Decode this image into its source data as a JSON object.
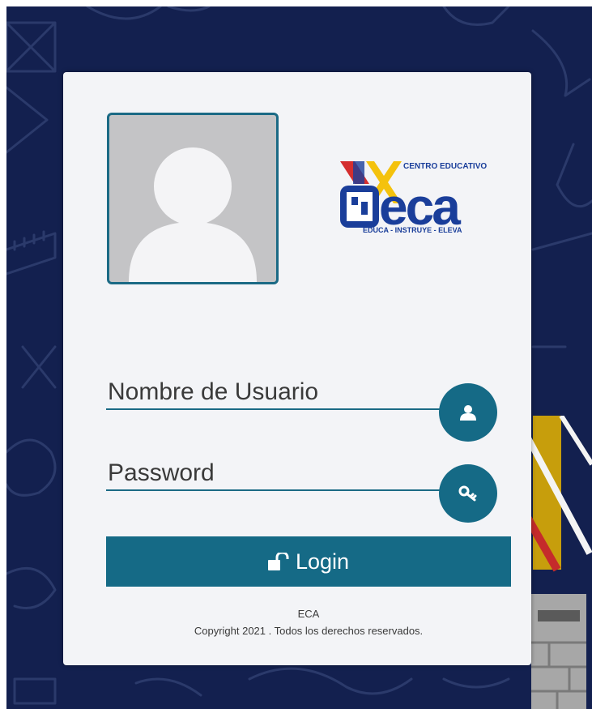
{
  "logo": {
    "top_text": "CENTRO EDUCATIVO",
    "main_text": "eca",
    "tagline": "EDUCA - INSTRUYE - ELEVA"
  },
  "form": {
    "username_placeholder": "Nombre de Usuario",
    "password_placeholder": "Password",
    "user_button_icon": "user-icon",
    "password_button_icon": "key-icon",
    "login_label": "Login",
    "login_icon": "unlock-icon"
  },
  "footer": {
    "org": "ECA",
    "copyright": "Copyright 2021 . Todos los derechos reservados."
  },
  "colors": {
    "background": "#13204f",
    "card": "#f3f4f7",
    "accent": "#156a86",
    "logo_blue": "#1a3e9a",
    "logo_yellow": "#f4c20d",
    "logo_red": "#d42e2e"
  }
}
